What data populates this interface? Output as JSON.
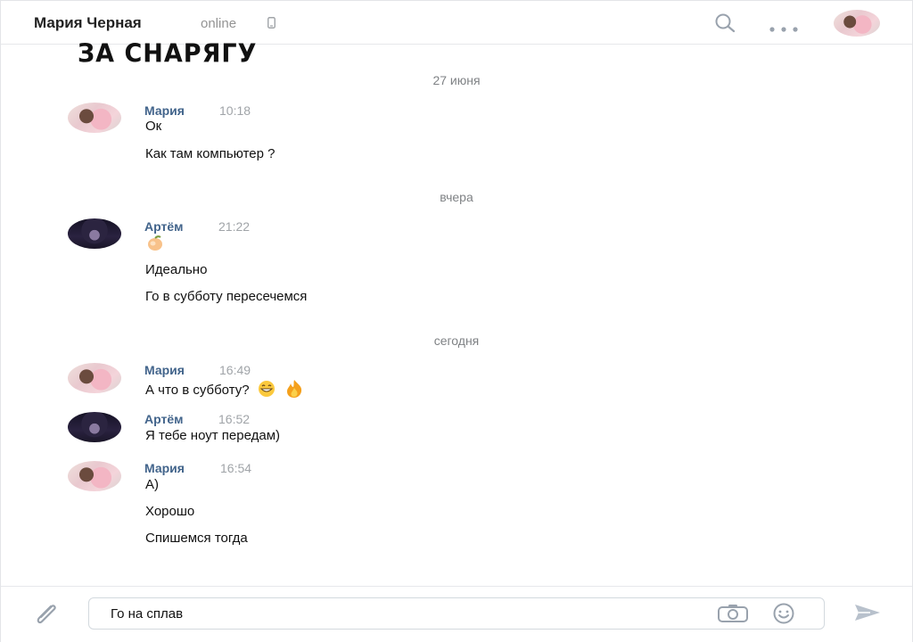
{
  "header": {
    "name": "Мария Черная",
    "status": "online",
    "icons": [
      "phone-icon",
      "search-icon",
      "more-icon"
    ]
  },
  "overlay_title": "ЗА СНАРЯГУ",
  "dates": {
    "d1": "27 июня",
    "d2": "вчера",
    "d3": "сегодня"
  },
  "groups": [
    {
      "author": "Мария",
      "time": "10:18",
      "messages": [
        "Ок",
        "Как там компьютер ?"
      ]
    },
    {
      "author": "Артём",
      "time": "21:22",
      "messages": [
        "Идеально",
        "Го в субботу пересечемся"
      ],
      "sticker": "peach-emoji-icon"
    },
    {
      "author": "Мария",
      "time": "16:49",
      "messages": [
        "А что в субботу?"
      ],
      "emojis": [
        "grin-emoji-icon",
        "fire-emoji-icon"
      ]
    },
    {
      "author": "Артём",
      "time": "16:52",
      "messages": [
        "Я тебе ноут передам)"
      ]
    },
    {
      "author": "Мария",
      "time": "16:54",
      "messages": [
        "А)",
        "Хорошо",
        "Спишемся тогда"
      ]
    }
  ],
  "composer": {
    "value": "Го на сплав",
    "icons": [
      "paperclip-icon",
      "camera-icon",
      "smile-icon",
      "send-icon"
    ]
  },
  "colors": {
    "author": "#42648b",
    "meta": "#a0a4a8",
    "border": "#e6e8eb"
  }
}
